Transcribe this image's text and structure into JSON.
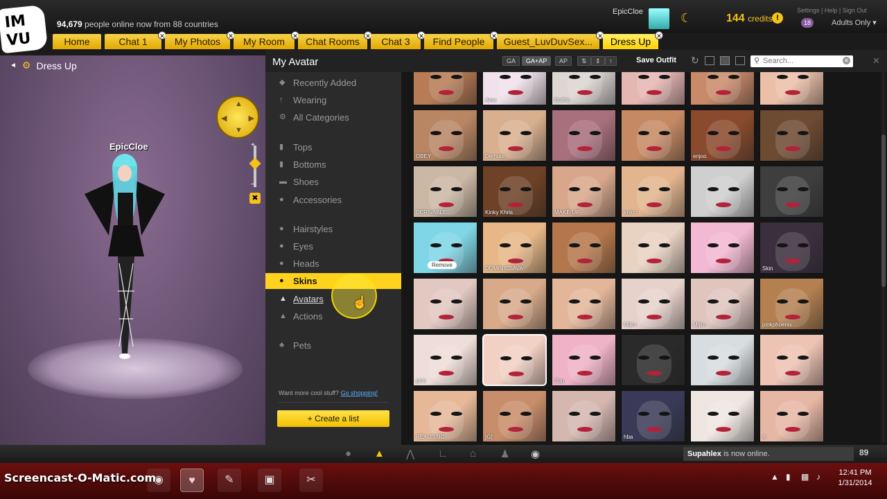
{
  "header": {
    "online_count": "94,679",
    "online_text": "people online now from 88 countries",
    "username": "EpicCloe",
    "credits": "144",
    "credits_label": "credits",
    "top_links": "Settings | Help | Sign Out",
    "age_badge": "18",
    "adults_only": "Adults Only"
  },
  "tabs": [
    {
      "label": "Home",
      "closable": false
    },
    {
      "label": "Chat 1",
      "closable": true
    },
    {
      "label": "My Photos",
      "closable": true
    },
    {
      "label": "My Room",
      "closable": true
    },
    {
      "label": "Chat Rooms",
      "closable": true
    },
    {
      "label": "Chat 3",
      "closable": true
    },
    {
      "label": "Find People",
      "closable": true
    },
    {
      "label": "Guest_LuvDuvSex...",
      "closable": true
    },
    {
      "label": "Dress Up",
      "closable": true,
      "active": true
    }
  ],
  "avatar_pane": {
    "title": "Dress Up",
    "avatar_name": "EpicCloe"
  },
  "catalog": {
    "title": "My Avatar",
    "filters": [
      "GA",
      "GA+AP",
      "AP"
    ],
    "save_outfit": "Save Outfit",
    "search_placeholder": "Search...",
    "sidebar": [
      {
        "label": "Recently Added",
        "icon": "tag-icon"
      },
      {
        "label": "Wearing",
        "icon": "hanger-icon"
      },
      {
        "label": "All Categories",
        "icon": "gear-icon"
      },
      {
        "label": "Tops",
        "icon": "shirt-icon"
      },
      {
        "label": "Bottoms",
        "icon": "pants-icon"
      },
      {
        "label": "Shoes",
        "icon": "shoe-icon"
      },
      {
        "label": "Accessories",
        "icon": "bag-icon"
      },
      {
        "label": "Hairstyles",
        "icon": "hair-icon"
      },
      {
        "label": "Eyes",
        "icon": "eye-icon"
      },
      {
        "label": "Heads",
        "icon": "head-icon"
      },
      {
        "label": "Skins",
        "icon": "skin-icon",
        "active": true
      },
      {
        "label": "Avatars",
        "icon": "person-icon",
        "link": true
      },
      {
        "label": "Actions",
        "icon": "action-icon"
      },
      {
        "label": "Pets",
        "icon": "paw-icon"
      }
    ],
    "more_text": "Want more cool stuff?",
    "shop_link": "Go shopping!",
    "create_list": "Create a list",
    "grid": [
      {
        "label": "",
        "tone": "#b77b55"
      },
      {
        "label": "Ame",
        "tone": "#f1e1ea"
      },
      {
        "label": "Dollfie",
        "tone": "#ddd6d2"
      },
      {
        "label": "",
        "tone": "#e6b6b3"
      },
      {
        "label": "",
        "tone": "#c98a6a"
      },
      {
        "label": "",
        "tone": "#ecc0a8"
      },
      {
        "label": "OBEY",
        "tone": "#b98663"
      },
      {
        "label": "Demure",
        "tone": "#d9b08f"
      },
      {
        "label": "",
        "tone": "#a86f7c"
      },
      {
        "label": "",
        "tone": "#c58963"
      },
      {
        "label": "enjoo",
        "tone": "#8a4a2d"
      },
      {
        "label": "",
        "tone": "#6d4a32"
      },
      {
        "label": "DERIVABLE",
        "tone": "#cbb8a4"
      },
      {
        "label": "Kinky Khris",
        "tone": "#6e4226"
      },
      {
        "label": "MAKE-UP",
        "tone": "#d8a78b"
      },
      {
        "label": "enjoo",
        "tone": "#e2b58e"
      },
      {
        "label": "",
        "tone": "#cfcfcf"
      },
      {
        "label": "",
        "tone": "#3e3e3e"
      },
      {
        "label": "",
        "tone": "#7fd6e6",
        "remove": "Remove"
      },
      {
        "label": "DOMINICSAVA",
        "tone": "#e7b787"
      },
      {
        "label": "",
        "tone": "#b4774b"
      },
      {
        "label": "",
        "tone": "#e8d2c2"
      },
      {
        "label": "",
        "tone": "#f3b8d2"
      },
      {
        "label": "Skin",
        "tone": "#3b2f3e"
      },
      {
        "label": "",
        "tone": "#e1c8c0"
      },
      {
        "label": "",
        "tone": "#d8aa8a"
      },
      {
        "label": "",
        "tone": "#e3b69a"
      },
      {
        "label": "Mijim",
        "tone": "#e7d2cb"
      },
      {
        "label": "Mijim",
        "tone": "#e0c5bf"
      },
      {
        "label": "pinkphoenix",
        "tone": "#b48050"
      },
      {
        "label": "pink",
        "tone": "#eeddd8"
      },
      {
        "label": "",
        "tone": "#f2d0c4",
        "selected": true
      },
      {
        "label": "Sug",
        "tone": "#efb2c6"
      },
      {
        "label": "",
        "tone": "#2a2a2a"
      },
      {
        "label": "",
        "tone": "#d8dde0"
      },
      {
        "label": "",
        "tone": "#edc3b3"
      },
      {
        "label": "REALISTIC",
        "tone": "#e6b898"
      },
      {
        "label": "[G]",
        "tone": "#c88d6a"
      },
      {
        "label": "",
        "tone": "#d5b7b0"
      },
      {
        "label": "hba",
        "tone": "#3a3a58"
      },
      {
        "label": "",
        "tone": "#efe6e2"
      },
      {
        "label": "A",
        "tone": "#e7b7a5"
      }
    ]
  },
  "bottombar": {
    "notify_user": "Supahlex",
    "notify_text": "is now online.",
    "notify_count": "89"
  },
  "taskbar": {
    "watermark": "Screencast-O-Matic.com",
    "time": "12:41 PM",
    "date": "1/31/2014"
  }
}
